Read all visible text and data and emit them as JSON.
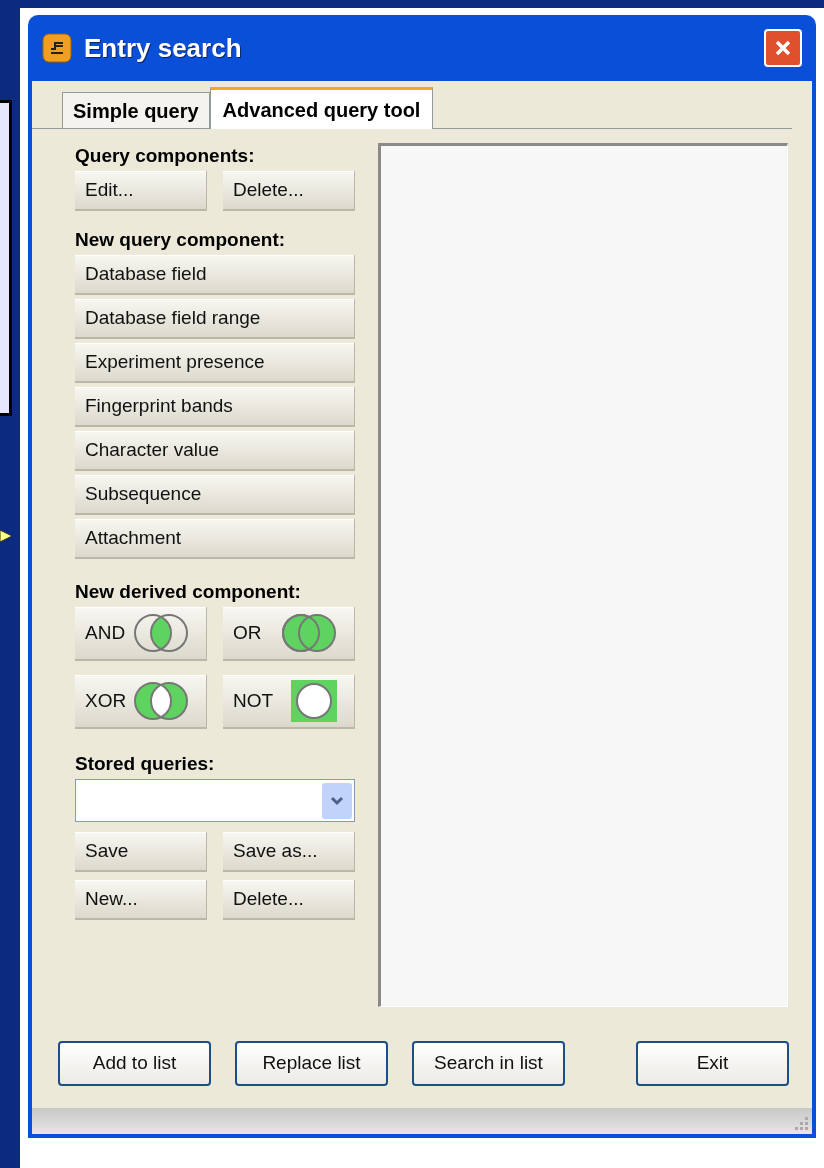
{
  "window": {
    "title": "Entry search"
  },
  "tabs": [
    {
      "label": "Simple query",
      "selected": false
    },
    {
      "label": "Advanced query tool",
      "selected": true
    }
  ],
  "query_components": {
    "label": "Query components:",
    "buttons": [
      "Edit...",
      "Delete..."
    ]
  },
  "new_query_component": {
    "label": "New query component:",
    "buttons": [
      "Database field",
      "Database field range",
      "Experiment presence",
      "Fingerprint bands",
      "Character value",
      "Subsequence",
      "Attachment"
    ]
  },
  "new_derived_component": {
    "label": "New derived component:",
    "buttons": [
      {
        "label": "AND",
        "kind": "and"
      },
      {
        "label": "OR",
        "kind": "or"
      },
      {
        "label": "XOR",
        "kind": "xor"
      },
      {
        "label": "NOT",
        "kind": "not"
      }
    ]
  },
  "stored_queries": {
    "label": "Stored queries:",
    "buttons": [
      "Save",
      "Save as...",
      "New...",
      "Delete..."
    ]
  },
  "footer_buttons": [
    "Add to list",
    "Replace list",
    "Search in list",
    "Exit"
  ]
}
